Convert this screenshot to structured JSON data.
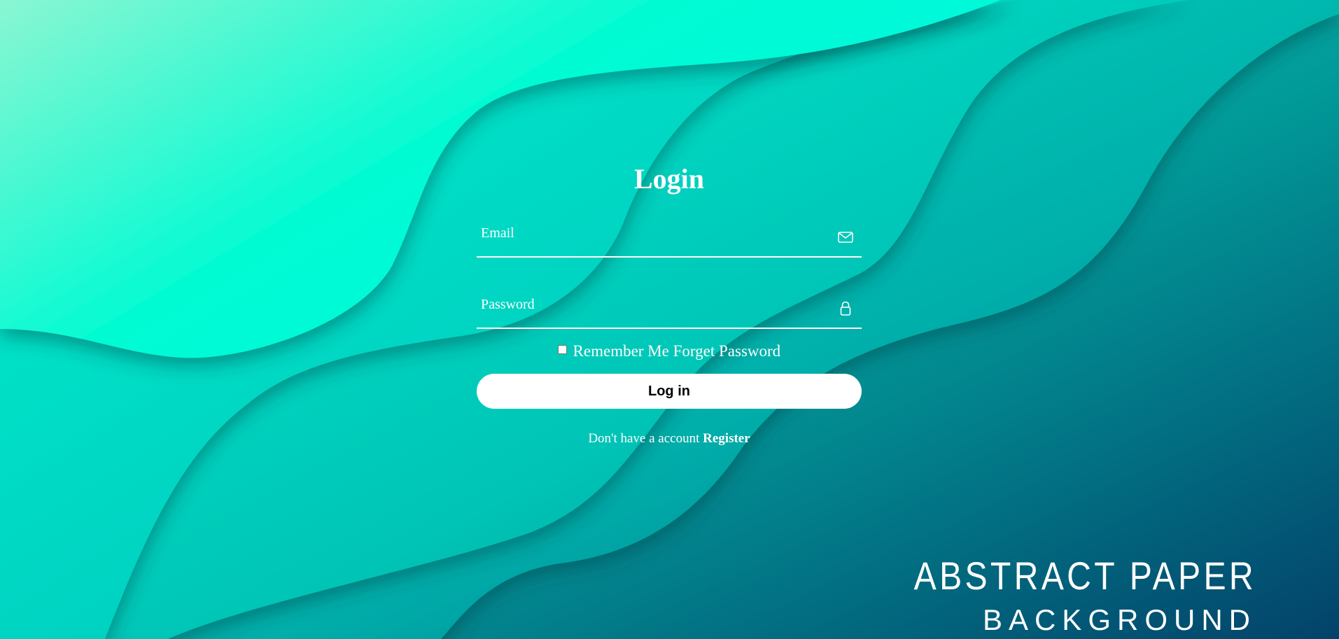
{
  "login": {
    "title": "Login",
    "email_placeholder": "Email",
    "password_placeholder": "Password",
    "remember_me": "Remember Me",
    "forget_password": "Forget Password",
    "login_button": "Log in",
    "no_account_text": "Don't have a account",
    "register_link": "Register"
  },
  "watermark": {
    "line1": "ABSTRACT PAPER",
    "line2": "BACKGROUND"
  },
  "icons": {
    "email": "envelope-icon",
    "password": "lock-icon"
  },
  "colors": {
    "background_light": "#7af7d0",
    "background_mid": "#00d4b8",
    "background_dark": "#034a6b",
    "text": "#ffffff",
    "button_bg": "#ffffff",
    "button_text": "#000000"
  }
}
